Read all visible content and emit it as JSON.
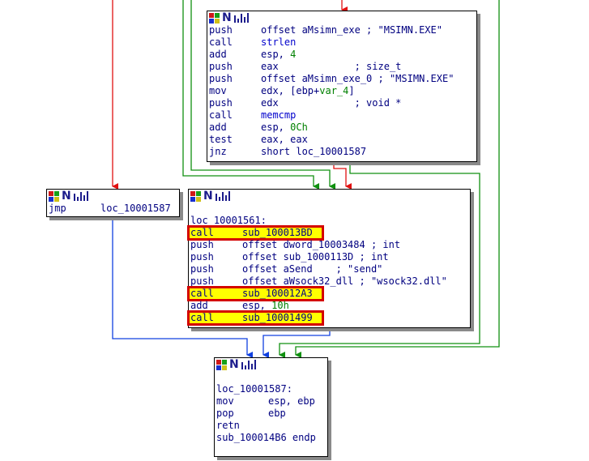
{
  "colors": {
    "edge_red": "#e01010",
    "edge_green": "#109010",
    "edge_blue": "#1040e0",
    "highlight_border": "#d40000",
    "highlight_fill": "#ffff00",
    "mnemonic": "#000080",
    "number": "#008000",
    "function": "#0000cc"
  },
  "node_header_icons": [
    "color-grid-icon",
    "n-letter-icon",
    "bar-graph-icon"
  ],
  "blocks": {
    "b1": {
      "lines": [
        {
          "mn": "push",
          "op": [
            {
              "t": "offset aMsimn_exe "
            },
            {
              "t": "; \"MSIMN.EXE\"",
              "c": "cmt"
            }
          ]
        },
        {
          "mn": "call",
          "op": [
            {
              "t": "strlen",
              "c": "fn"
            }
          ]
        },
        {
          "mn": "add",
          "op": [
            {
              "t": "esp, "
            },
            {
              "t": "4",
              "c": "num"
            }
          ]
        },
        {
          "mn": "push",
          "op": [
            {
              "t": "eax             "
            },
            {
              "t": "; size_t",
              "c": "cmt"
            }
          ]
        },
        {
          "mn": "push",
          "op": [
            {
              "t": "offset aMsimn_exe_0 "
            },
            {
              "t": "; \"MSIMN.EXE\"",
              "c": "cmt"
            }
          ]
        },
        {
          "mn": "mov",
          "op": [
            {
              "t": "edx, [ebp+"
            },
            {
              "t": "var_4",
              "c": "var"
            },
            {
              "t": "]"
            }
          ]
        },
        {
          "mn": "push",
          "op": [
            {
              "t": "edx             "
            },
            {
              "t": "; void *",
              "c": "cmt"
            }
          ]
        },
        {
          "mn": "call",
          "op": [
            {
              "t": "memcmp",
              "c": "fn"
            }
          ]
        },
        {
          "mn": "add",
          "op": [
            {
              "t": "esp, "
            },
            {
              "t": "0Ch",
              "c": "num"
            }
          ]
        },
        {
          "mn": "test",
          "op": [
            {
              "t": "eax, eax"
            }
          ]
        },
        {
          "mn": "jnz",
          "op": [
            {
              "t": "short loc_10001587"
            }
          ]
        }
      ]
    },
    "b2": {
      "lines": [
        {
          "mn": "jmp",
          "op": [
            {
              "t": "loc_10001587"
            }
          ]
        }
      ]
    },
    "b3": {
      "lines": [
        {
          "mn": "",
          "op": [
            {
              "t": ""
            }
          ]
        },
        {
          "label": "loc_10001561:"
        },
        {
          "mn": "call",
          "op": [
            {
              "t": "sub_100013BD"
            }
          ],
          "hl": true
        },
        {
          "mn": "push",
          "op": [
            {
              "t": "offset dword_10003484 "
            },
            {
              "t": "; int",
              "c": "cmt"
            }
          ]
        },
        {
          "mn": "push",
          "op": [
            {
              "t": "offset sub_1000113D "
            },
            {
              "t": "; int",
              "c": "cmt"
            }
          ]
        },
        {
          "mn": "push",
          "op": [
            {
              "t": "offset aSend    "
            },
            {
              "t": "; \"send\"",
              "c": "cmt"
            }
          ]
        },
        {
          "mn": "push",
          "op": [
            {
              "t": "offset aWsock32_dll "
            },
            {
              "t": "; \"wsock32.dll\"",
              "c": "cmt"
            }
          ]
        },
        {
          "mn": "call",
          "op": [
            {
              "t": "sub_100012A3"
            }
          ],
          "hl": true
        },
        {
          "mn": "add",
          "op": [
            {
              "t": "esp, "
            },
            {
              "t": "10h",
              "c": "num"
            }
          ]
        },
        {
          "mn": "call",
          "op": [
            {
              "t": "sub_10001499"
            }
          ],
          "hl": true
        }
      ]
    },
    "b4": {
      "lines": [
        {
          "mn": "",
          "op": [
            {
              "t": ""
            }
          ]
        },
        {
          "label": "loc_10001587:"
        },
        {
          "mn": "mov",
          "op": [
            {
              "t": "esp, ebp"
            }
          ]
        },
        {
          "mn": "pop",
          "op": [
            {
              "t": "ebp"
            }
          ]
        },
        {
          "mn": "retn",
          "op": [
            {
              "t": ""
            }
          ]
        },
        {
          "label": "sub_100014B6 endp"
        }
      ]
    }
  }
}
